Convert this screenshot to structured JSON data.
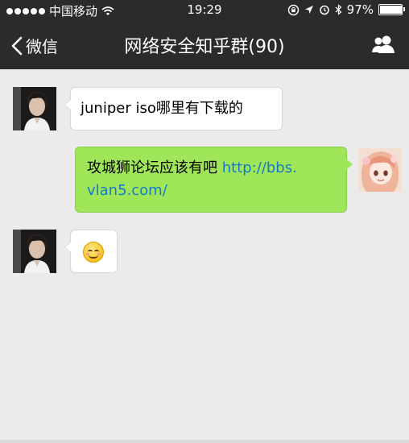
{
  "status_bar": {
    "carrier": "中国移动",
    "time": "19:29",
    "battery": "97%",
    "battery_level": 0.97
  },
  "nav": {
    "back_label": "微信",
    "title": "网络安全知乎群(90)"
  },
  "messages": [
    {
      "text": "juniper iso哪里有下载的"
    },
    {
      "text": "攻城狮论坛应该有吧 ",
      "link_line1": "http://bbs.",
      "link_line2": "vlan5.com/"
    },
    {
      "emoji": "smiling-face-icon"
    }
  ]
}
